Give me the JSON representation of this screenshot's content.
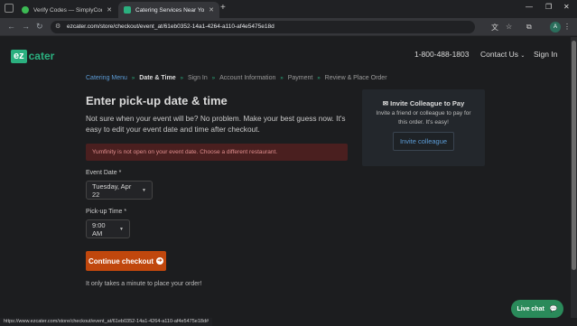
{
  "browser": {
    "tabs": [
      {
        "title": "Verify Codes — SimplyCodes",
        "active": false,
        "favicon_color": "#3cba54"
      },
      {
        "title": "Catering Services Near You - O",
        "active": true,
        "favicon_color": "#2bb07f"
      }
    ],
    "url": "ezcater.com/store/checkout/event_at/61eb0352-14a1-4264-a110-af4e5475e18d",
    "avatar_letter": "A",
    "status_url": "https://www.ezcater.com/store/checkout/event_at/61eb0352-14a1-4264-a110-af4e5475e18d#"
  },
  "header": {
    "logo_ez": "ez",
    "logo_cater": "cater",
    "phone": "1-800-488-1803",
    "contact": "Contact Us",
    "signin": "Sign In"
  },
  "breadcrumb": [
    {
      "label": "Catering Menu",
      "state": "link"
    },
    {
      "label": "Date & Time",
      "state": "active"
    },
    {
      "label": "Sign In",
      "state": "inactive"
    },
    {
      "label": "Account Information",
      "state": "inactive"
    },
    {
      "label": "Payment",
      "state": "inactive"
    },
    {
      "label": "Review & Place Order",
      "state": "inactive"
    }
  ],
  "main": {
    "title": "Enter pick-up date & time",
    "subtitle": "Not sure when your event will be? No problem. Make your best guess now. It's easy to edit your event date and time after checkout.",
    "alert": "Yumfinity is not open on your event date. Choose a different restaurant.",
    "event_date_label": "Event Date *",
    "event_date_value": "Tuesday, Apr 22",
    "pickup_time_label": "Pick-up Time *",
    "pickup_time_value": "9:00 AM",
    "continue_label": "Continue checkout",
    "footnote": "It only takes a minute to place your order!"
  },
  "invite": {
    "title": "Invite Colleague to Pay",
    "text": "Invite a friend or colleague to pay for this order. It's easy!",
    "button": "Invite colleague"
  },
  "livechat": {
    "label": "Live chat"
  },
  "colors": {
    "brand_green": "#2bb07f",
    "cta_orange": "#c0470d",
    "link_blue": "#5b9bd5",
    "alert_bg": "#4a1f1f"
  }
}
